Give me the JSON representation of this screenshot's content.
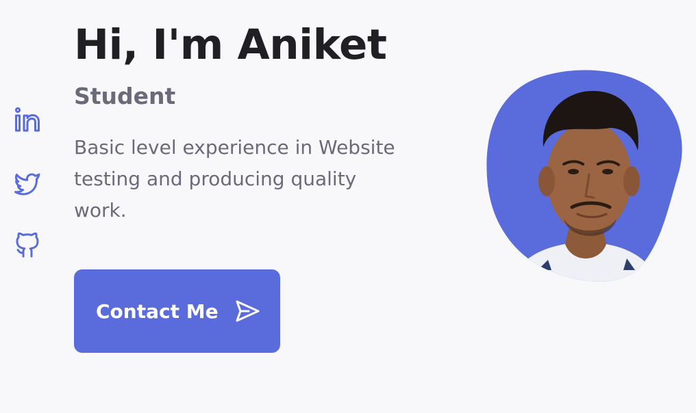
{
  "hero": {
    "title": "Hi, I'm Aniket",
    "subtitle": "Student",
    "description": "Basic level experience in Website testing and producing quality work.",
    "contact_label": "Contact Me"
  },
  "social": [
    {
      "name": "linkedin-icon"
    },
    {
      "name": "twitter-icon"
    },
    {
      "name": "github-icon"
    }
  ],
  "colors": {
    "accent": "#5a6bdc",
    "background": "#f8f8fb",
    "title": "#1f1f24",
    "text": "#6b6a78"
  }
}
